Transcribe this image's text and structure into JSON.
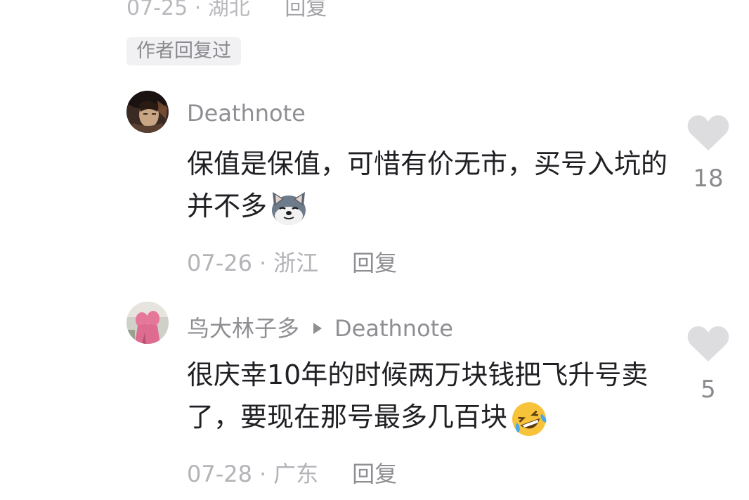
{
  "top_meta": {
    "date": "07-25",
    "location": "湖北",
    "reply_label": "回复"
  },
  "author_replied_tag": "作者回复过",
  "comments": [
    {
      "username": "Deathnote",
      "text": "保值是保值，可惜有价无市，买号入坑的并不多",
      "emoji": "doge-dog-emoji",
      "date": "07-26",
      "location": "浙江",
      "reply_label": "回复",
      "likes": "18"
    },
    {
      "username": "鸟大林子多",
      "reply_to": "Deathnote",
      "text": "很庆幸10年的时候两万块钱把飞升号卖了，要现在那号最多几百块",
      "emoji": "rolling-laugh-emoji",
      "date": "07-28",
      "location": "广东",
      "reply_label": "回复",
      "likes": "5"
    }
  ],
  "colors": {
    "username": "#8e8e93",
    "body_text": "#202024",
    "meta": "#b3b3b8",
    "heart": "#dddde0",
    "tag_bg": "#f1f1f3"
  }
}
